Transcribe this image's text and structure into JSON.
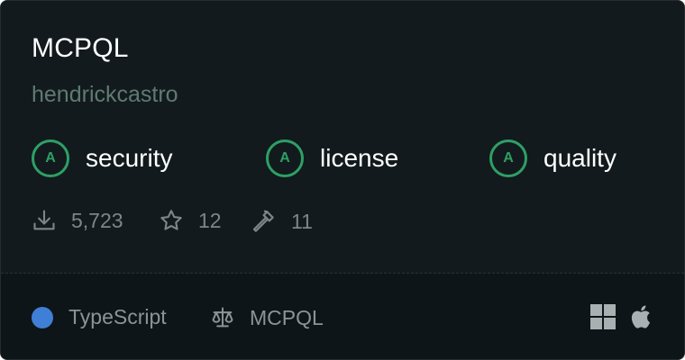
{
  "card": {
    "title": "MCPQL",
    "author": "hendrickcastro",
    "grades": [
      {
        "grade": "A",
        "label": "security"
      },
      {
        "grade": "A",
        "label": "license"
      },
      {
        "grade": "A",
        "label": "quality"
      }
    ],
    "stats": {
      "downloads": "5,723",
      "stars": "12",
      "tools": "11"
    },
    "footer": {
      "language": "TypeScript",
      "language_color": "#3f7fd6",
      "license": "MCPQL",
      "platforms": [
        "windows-icon",
        "apple-icon"
      ]
    }
  },
  "colors": {
    "background": "#121a1d",
    "grade_accent": "#2e9f65",
    "muted_text": "#7b8689"
  }
}
